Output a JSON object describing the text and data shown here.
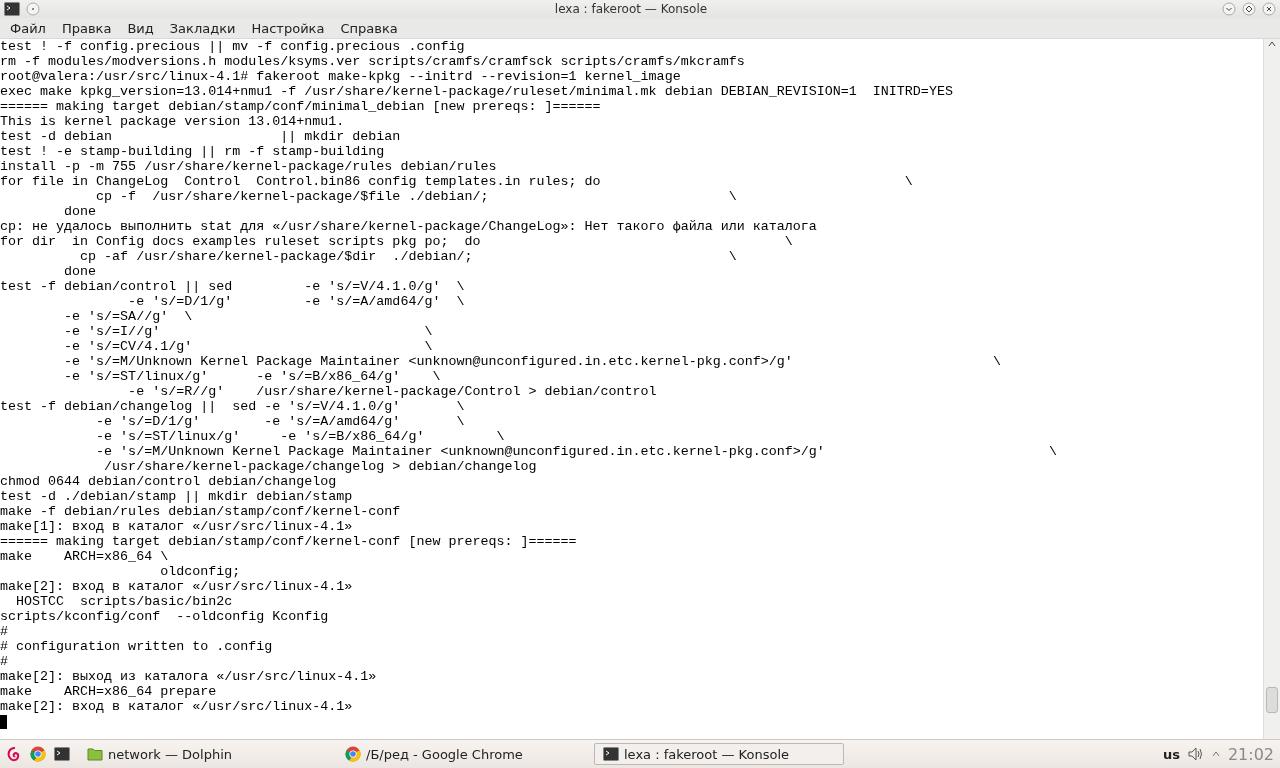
{
  "window": {
    "title": "lexa : fakeroot — Konsole"
  },
  "menu": [
    "Файл",
    "Правка",
    "Вид",
    "Закладки",
    "Настройка",
    "Справка"
  ],
  "terminal": {
    "lines": [
      "test ! -f config.precious || mv -f config.precious .config",
      "rm -f modules/modversions.h modules/ksyms.ver scripts/cramfs/cramfsck scripts/cramfs/mkcramfs",
      "root@valera:/usr/src/linux-4.1# fakeroot make-kpkg --initrd --revision=1 kernel_image",
      "exec make kpkg_version=13.014+nmu1 -f /usr/share/kernel-package/ruleset/minimal.mk debian DEBIAN_REVISION=1  INITRD=YES",
      "====== making target debian/stamp/conf/minimal_debian [new prereqs: ]======",
      "This is kernel package version 13.014+nmu1.",
      "test -d debian                     || mkdir debian",
      "test ! -e stamp-building || rm -f stamp-building",
      "install -p -m 755 /usr/share/kernel-package/rules debian/rules",
      "for file in ChangeLog  Control  Control.bin86 config templates.in rules; do                                      \\",
      "            cp -f  /usr/share/kernel-package/$file ./debian/;                              \\",
      "        done",
      "cp: не удалось выполнить stat для «/usr/share/kernel-package/ChangeLog»: Нет такого файла или каталога",
      "for dir  in Config docs examples ruleset scripts pkg po;  do                                      \\",
      "          cp -af /usr/share/kernel-package/$dir  ./debian/;                                \\",
      "        done",
      "test -f debian/control || sed         -e 's/=V/4.1.0/g'  \\",
      "                -e 's/=D/1/g'         -e 's/=A/amd64/g'  \\",
      "        -e 's/=SA//g'  \\",
      "        -e 's/=I//g'                                 \\",
      "        -e 's/=CV/4.1/g'                             \\",
      "        -e 's/=M/Unknown Kernel Package Maintainer <unknown@unconfigured.in.etc.kernel-pkg.conf>/g'                         \\",
      "        -e 's/=ST/linux/g'      -e 's/=B/x86_64/g'    \\",
      "                -e 's/=R//g'    /usr/share/kernel-package/Control > debian/control",
      "test -f debian/changelog ||  sed -e 's/=V/4.1.0/g'       \\",
      "            -e 's/=D/1/g'        -e 's/=A/amd64/g'       \\",
      "            -e 's/=ST/linux/g'     -e 's/=B/x86_64/g'         \\",
      "            -e 's/=M/Unknown Kernel Package Maintainer <unknown@unconfigured.in.etc.kernel-pkg.conf>/g'                            \\",
      "             /usr/share/kernel-package/changelog > debian/changelog",
      "chmod 0644 debian/control debian/changelog",
      "test -d ./debian/stamp || mkdir debian/stamp",
      "make -f debian/rules debian/stamp/conf/kernel-conf",
      "make[1]: вход в каталог «/usr/src/linux-4.1»",
      "====== making target debian/stamp/conf/kernel-conf [new prereqs: ]======",
      "make    ARCH=x86_64 \\",
      "                    oldconfig;",
      "make[2]: вход в каталог «/usr/src/linux-4.1»",
      "  HOSTCC  scripts/basic/bin2c",
      "scripts/kconfig/conf  --oldconfig Kconfig",
      "#",
      "# configuration written to .config",
      "#",
      "make[2]: выход из каталога «/usr/src/linux-4.1»",
      "make    ARCH=x86_64 prepare",
      "make[2]: вход в каталог «/usr/src/linux-4.1»"
    ]
  },
  "taskbar": {
    "tasks": [
      {
        "kind": "folder",
        "label": "network — Dolphin",
        "selected": false
      },
      {
        "kind": "browser",
        "label": "/Б/ред - Google Chrome",
        "selected": false
      },
      {
        "kind": "terminal",
        "label": "lexa : fakeroot — Konsole",
        "selected": true
      }
    ],
    "keyboard_layout": "us",
    "clock": "21:02"
  }
}
